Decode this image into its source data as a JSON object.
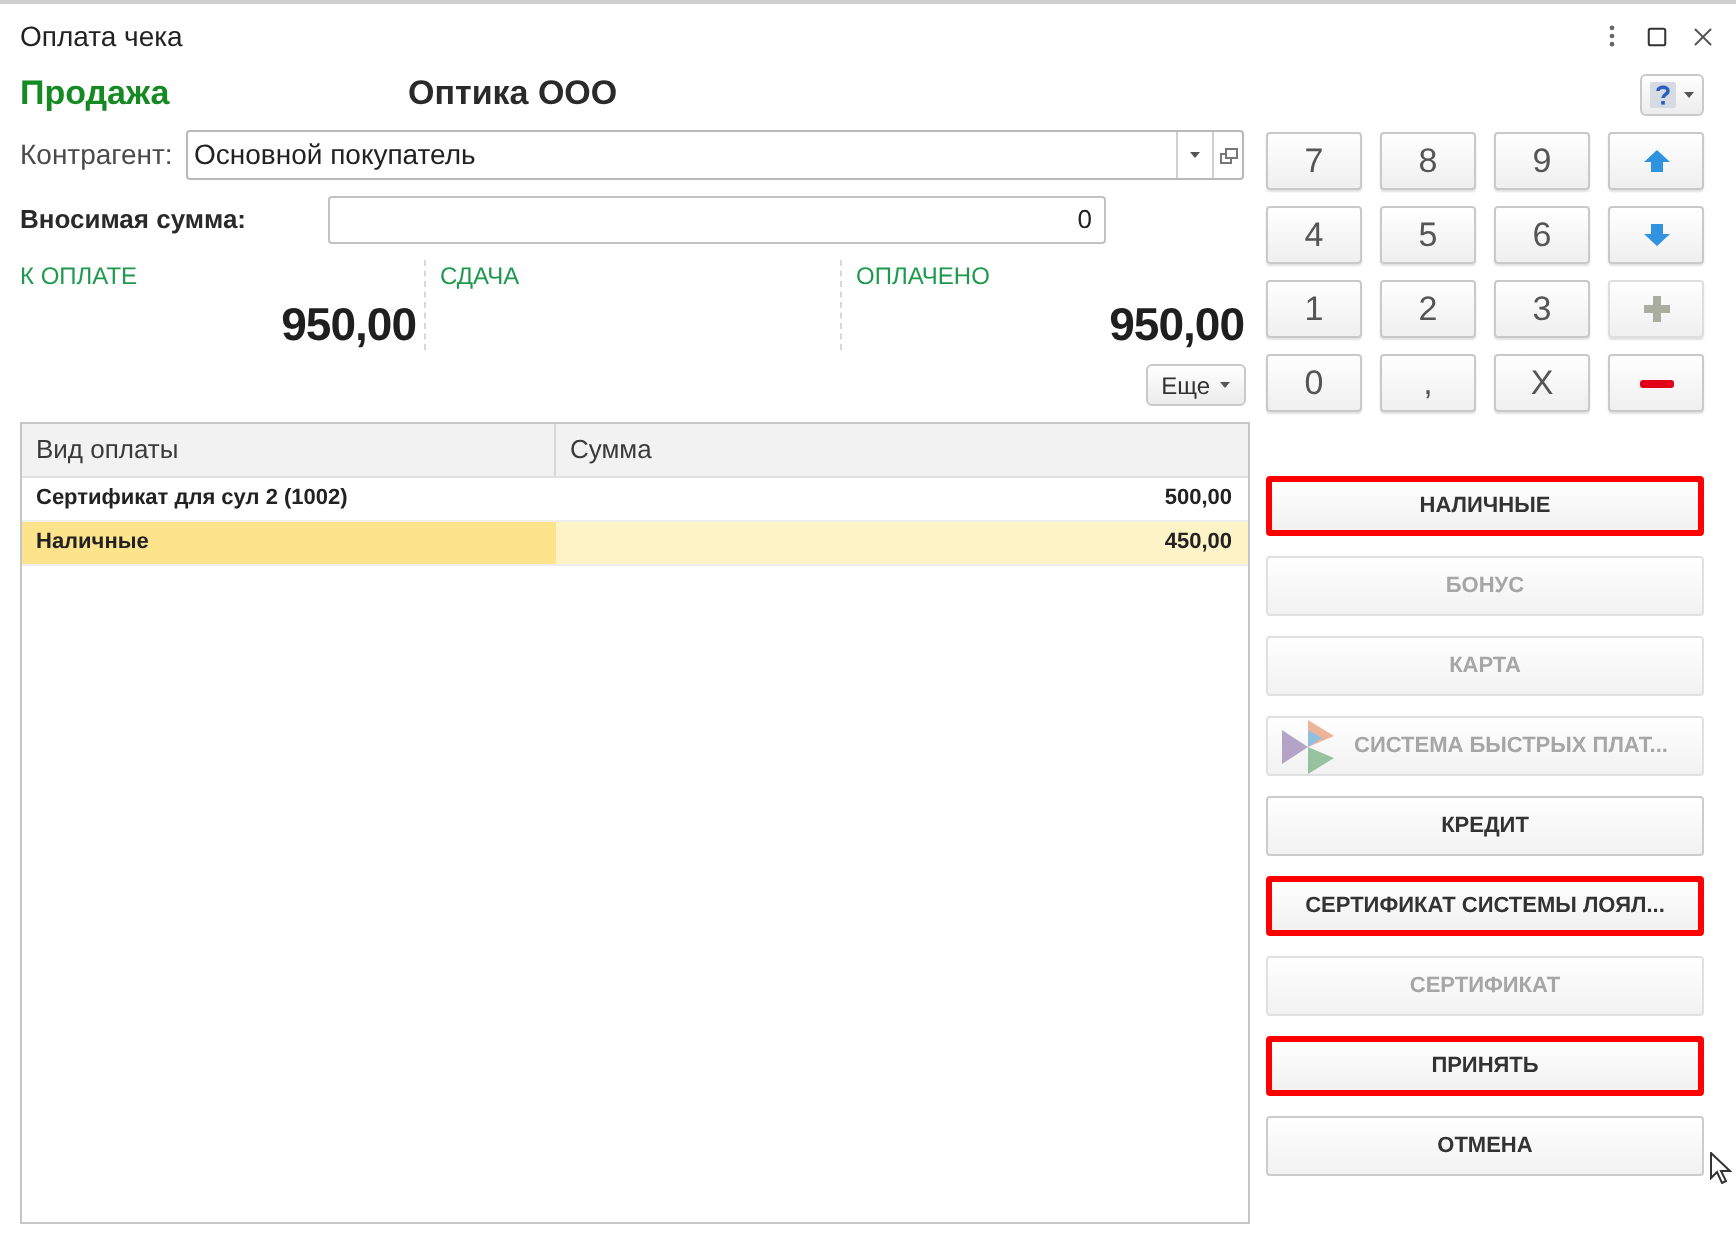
{
  "window": {
    "title": "Оплата чека"
  },
  "header": {
    "operation": "Продажа",
    "organization": "Оптика ООО"
  },
  "counterparty": {
    "label": "Контрагент:",
    "value": "Основной покупатель"
  },
  "amount_input": {
    "label": "Вносимая сумма:",
    "value": "0"
  },
  "totals": [
    {
      "label": "К ОПЛАТЕ",
      "value": "950,00"
    },
    {
      "label": "СДАЧА"
    },
    {
      "label": "ОПЛАЧЕНО",
      "value": "950,00"
    }
  ],
  "more_button": {
    "label": "Еще"
  },
  "payments_table": {
    "columns": [
      "Вид оплаты",
      "Сумма"
    ],
    "rows": [
      {
        "cells": [
          "Сертификат для сул 2 (1002)",
          "500,00"
        ],
        "selected": false
      },
      {
        "cells": [
          "Наличные",
          "450,00"
        ],
        "selected": true
      }
    ]
  },
  "keypad": [
    {
      "kind": "text",
      "label": "7",
      "disabled": false
    },
    {
      "kind": "text",
      "label": "8",
      "disabled": false
    },
    {
      "kind": "text",
      "label": "9",
      "disabled": false
    },
    {
      "kind": "arrow-up",
      "disabled": false
    },
    {
      "kind": "text",
      "label": "4",
      "disabled": false
    },
    {
      "kind": "text",
      "label": "5",
      "disabled": false
    },
    {
      "kind": "text",
      "label": "6",
      "disabled": false
    },
    {
      "kind": "arrow-down",
      "disabled": false
    },
    {
      "kind": "text",
      "label": "1",
      "disabled": false
    },
    {
      "kind": "text",
      "label": "2",
      "disabled": false
    },
    {
      "kind": "text",
      "label": "3",
      "disabled": false
    },
    {
      "kind": "plus",
      "disabled": true
    },
    {
      "kind": "text",
      "label": "0",
      "disabled": false
    },
    {
      "kind": "text",
      "label": ",",
      "disabled": false
    },
    {
      "kind": "text",
      "label": "X",
      "disabled": false
    },
    {
      "kind": "minus",
      "disabled": false
    }
  ],
  "payment_buttons": [
    {
      "kind": "plain",
      "label": "НАЛИЧНЫЕ",
      "disabled": false,
      "highlighted": true
    },
    {
      "kind": "plain",
      "label": "БОНУС",
      "disabled": true,
      "highlighted": false
    },
    {
      "kind": "plain",
      "label": "КАРТА",
      "disabled": true,
      "highlighted": false
    },
    {
      "kind": "logo",
      "label": "СИСТЕМА БЫСТРЫХ ПЛАТ...",
      "disabled": true,
      "highlighted": false
    },
    {
      "kind": "plain",
      "label": "КРЕДИТ",
      "disabled": false,
      "highlighted": false
    },
    {
      "kind": "plain",
      "label": "СЕРТИФИКАТ СИСТЕМЫ ЛОЯЛ...",
      "disabled": false,
      "highlighted": true
    },
    {
      "kind": "plain",
      "label": "СЕРТИФИКАТ",
      "disabled": true,
      "highlighted": false
    },
    {
      "kind": "plain",
      "label": "ПРИНЯТЬ",
      "disabled": false,
      "highlighted": true
    },
    {
      "kind": "plain",
      "label": "ОТМЕНА",
      "disabled": false,
      "highlighted": false
    }
  ]
}
